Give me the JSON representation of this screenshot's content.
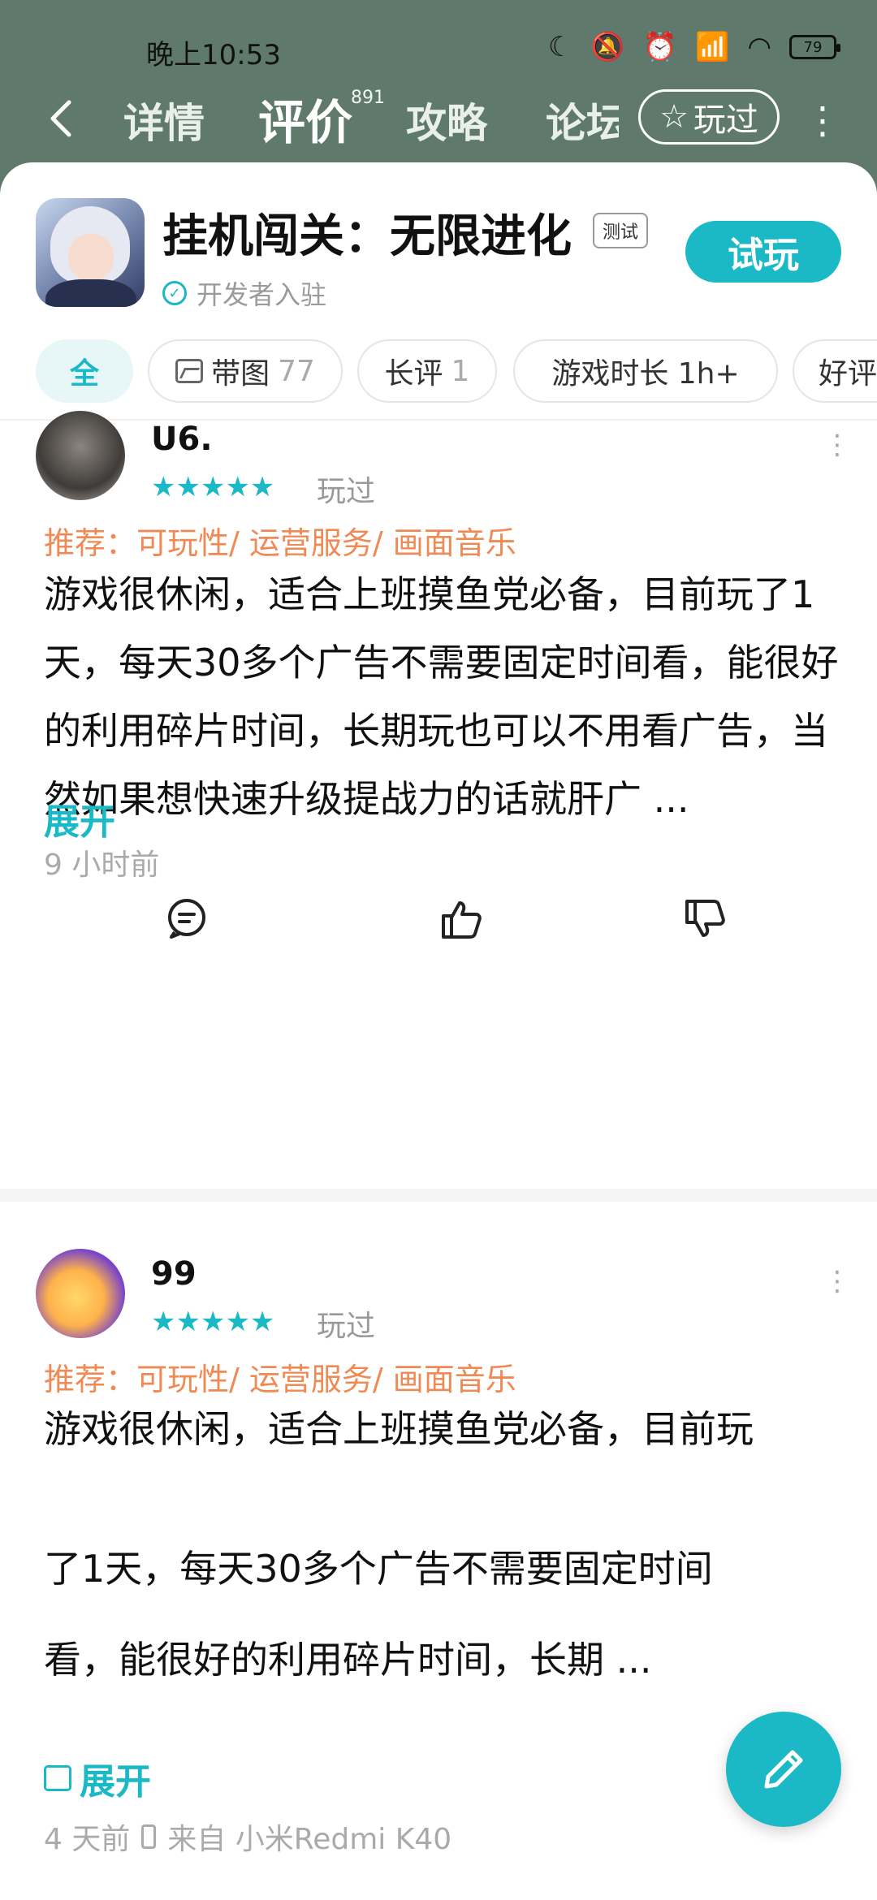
{
  "status_bar": {
    "time": "晚上10:53",
    "battery": "79"
  },
  "nav": {
    "tabs": [
      {
        "label": "详情"
      },
      {
        "label": "评价"
      },
      {
        "label": "攻略"
      },
      {
        "label": "论坛"
      }
    ],
    "review_count": "891",
    "played_button": "玩过"
  },
  "game": {
    "title": "挂机闯关：无限进化",
    "badge": "测试",
    "developer_note": "开发者入驻",
    "try_button": "试玩"
  },
  "filters": [
    {
      "label": "全",
      "count": ""
    },
    {
      "label": "带图",
      "count": "77"
    },
    {
      "label": "长评",
      "count": "1"
    },
    {
      "label": "游戏时长 1h+",
      "count": ""
    },
    {
      "label": "好评",
      "count": ""
    }
  ],
  "reviews": [
    {
      "username": "U6.",
      "rating": 5,
      "stars": "★★★★★",
      "played": "玩过",
      "recommend": "推荐：可玩性/ 运营服务/ 画面音乐",
      "text": "游戏很休闲，适合上班摸鱼党必备，目前玩了1天，每天30多个广告不需要固定时间看，能很好的利用碎片时间，长期玩也可以不用看广告，当然如果想快速升级提战力的话就肝广 ...",
      "expand": "展开",
      "time": "9 小时前"
    },
    {
      "username": "99",
      "rating": 5,
      "stars": "★★★★★",
      "played": "玩过",
      "recommend": "推荐：可玩性/ 运营服务/ 画面音乐",
      "text_lines": [
        "游戏很休闲，适合上班摸鱼党必备，目前玩",
        "了1天，每天30多个广告不需要固定时间",
        "看，能很好的利用碎片时间，长期 ..."
      ],
      "expand": "展开",
      "time": "4 天前",
      "device": "来自 小米Redmi K40"
    }
  ]
}
